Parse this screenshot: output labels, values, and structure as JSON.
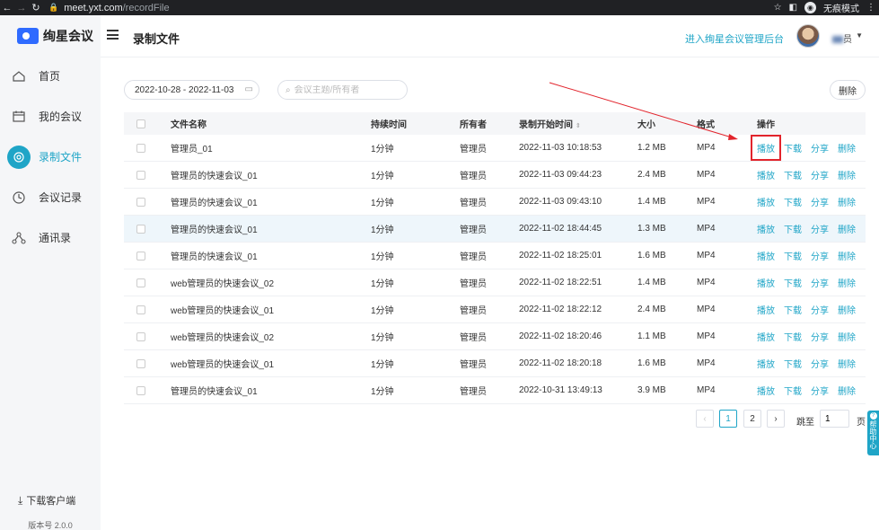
{
  "browser": {
    "url_host": "meet.yxt.com",
    "url_path": "/recordFile",
    "incognito_label": "无痕模式"
  },
  "sidebar": {
    "logo_text": "绚星会议",
    "items": [
      {
        "label": "首页",
        "icon": "home-icon"
      },
      {
        "label": "我的会议",
        "icon": "calendar-icon"
      },
      {
        "label": "录制文件",
        "icon": "record-icon",
        "active": true
      },
      {
        "label": "会议记录",
        "icon": "clock-icon"
      },
      {
        "label": "通讯录",
        "icon": "contacts-icon"
      }
    ],
    "download_label": "下载客户端",
    "version": "版本号 2.0.0"
  },
  "header": {
    "title": "录制文件",
    "admin_link": "进入绚星会议管理后台",
    "user_name": "员"
  },
  "toolbar": {
    "date_range": "2022-10-28 - 2022-11-03",
    "search_placeholder": "会议主题/所有者",
    "delete_label": "删除"
  },
  "table": {
    "columns": {
      "name": "文件名称",
      "duration": "持续时间",
      "owner": "所有者",
      "start_time": "录制开始时间",
      "size": "大小",
      "format": "格式",
      "ops": "操作"
    },
    "ops": {
      "play": "播放",
      "download": "下载",
      "share": "分享",
      "delete": "删除"
    },
    "rows": [
      {
        "name_visible": "管理员_01",
        "duration": "1分钟",
        "owner": "管理员",
        "start_time": "2022-11-03 10:18:53",
        "size": "1.2 MB",
        "format": "MP4"
      },
      {
        "name_visible": "管理员的快速会议_01",
        "duration": "1分钟",
        "owner": "管理员",
        "start_time": "2022-11-03 09:44:23",
        "size": "2.4 MB",
        "format": "MP4"
      },
      {
        "name_visible": "管理员的快速会议_01",
        "duration": "1分钟",
        "owner": "管理员",
        "start_time": "2022-11-03 09:43:10",
        "size": "1.4 MB",
        "format": "MP4"
      },
      {
        "name_visible": "管理员的快速会议_01",
        "duration": "1分钟",
        "owner": "管理员",
        "start_time": "2022-11-02 18:44:45",
        "size": "1.3 MB",
        "format": "MP4",
        "highlight": true
      },
      {
        "name_visible": "管理员的快速会议_01",
        "duration": "1分钟",
        "owner": "管理员",
        "start_time": "2022-11-02 18:25:01",
        "size": "1.6 MB",
        "format": "MP4"
      },
      {
        "name_visible": "web管理员的快速会议_02",
        "duration": "1分钟",
        "owner": "管理员",
        "start_time": "2022-11-02 18:22:51",
        "size": "1.4 MB",
        "format": "MP4"
      },
      {
        "name_visible": "web管理员的快速会议_01",
        "duration": "1分钟",
        "owner": "管理员",
        "start_time": "2022-11-02 18:22:12",
        "size": "2.4 MB",
        "format": "MP4"
      },
      {
        "name_visible": "web管理员的快速会议_02",
        "duration": "1分钟",
        "owner": "管理员",
        "start_time": "2022-11-02 18:20:46",
        "size": "1.1 MB",
        "format": "MP4"
      },
      {
        "name_visible": "web管理员的快速会议_01",
        "duration": "1分钟",
        "owner": "管理员",
        "start_time": "2022-11-02 18:20:18",
        "size": "1.6 MB",
        "format": "MP4"
      },
      {
        "name_visible": "管理员的快速会议_01",
        "duration": "1分钟",
        "owner": "管理员",
        "start_time": "2022-10-31 13:49:13",
        "size": "3.9 MB",
        "format": "MP4"
      }
    ]
  },
  "pagination": {
    "prev": "‹",
    "pages": [
      "1",
      "2"
    ],
    "current": "1",
    "next": "›",
    "jump_label": "跳至",
    "jump_value": "1",
    "unit": "页"
  },
  "help": {
    "label": "帮助中心"
  },
  "colors": {
    "accent": "#1fa5c7",
    "annotation": "#e2242c"
  }
}
